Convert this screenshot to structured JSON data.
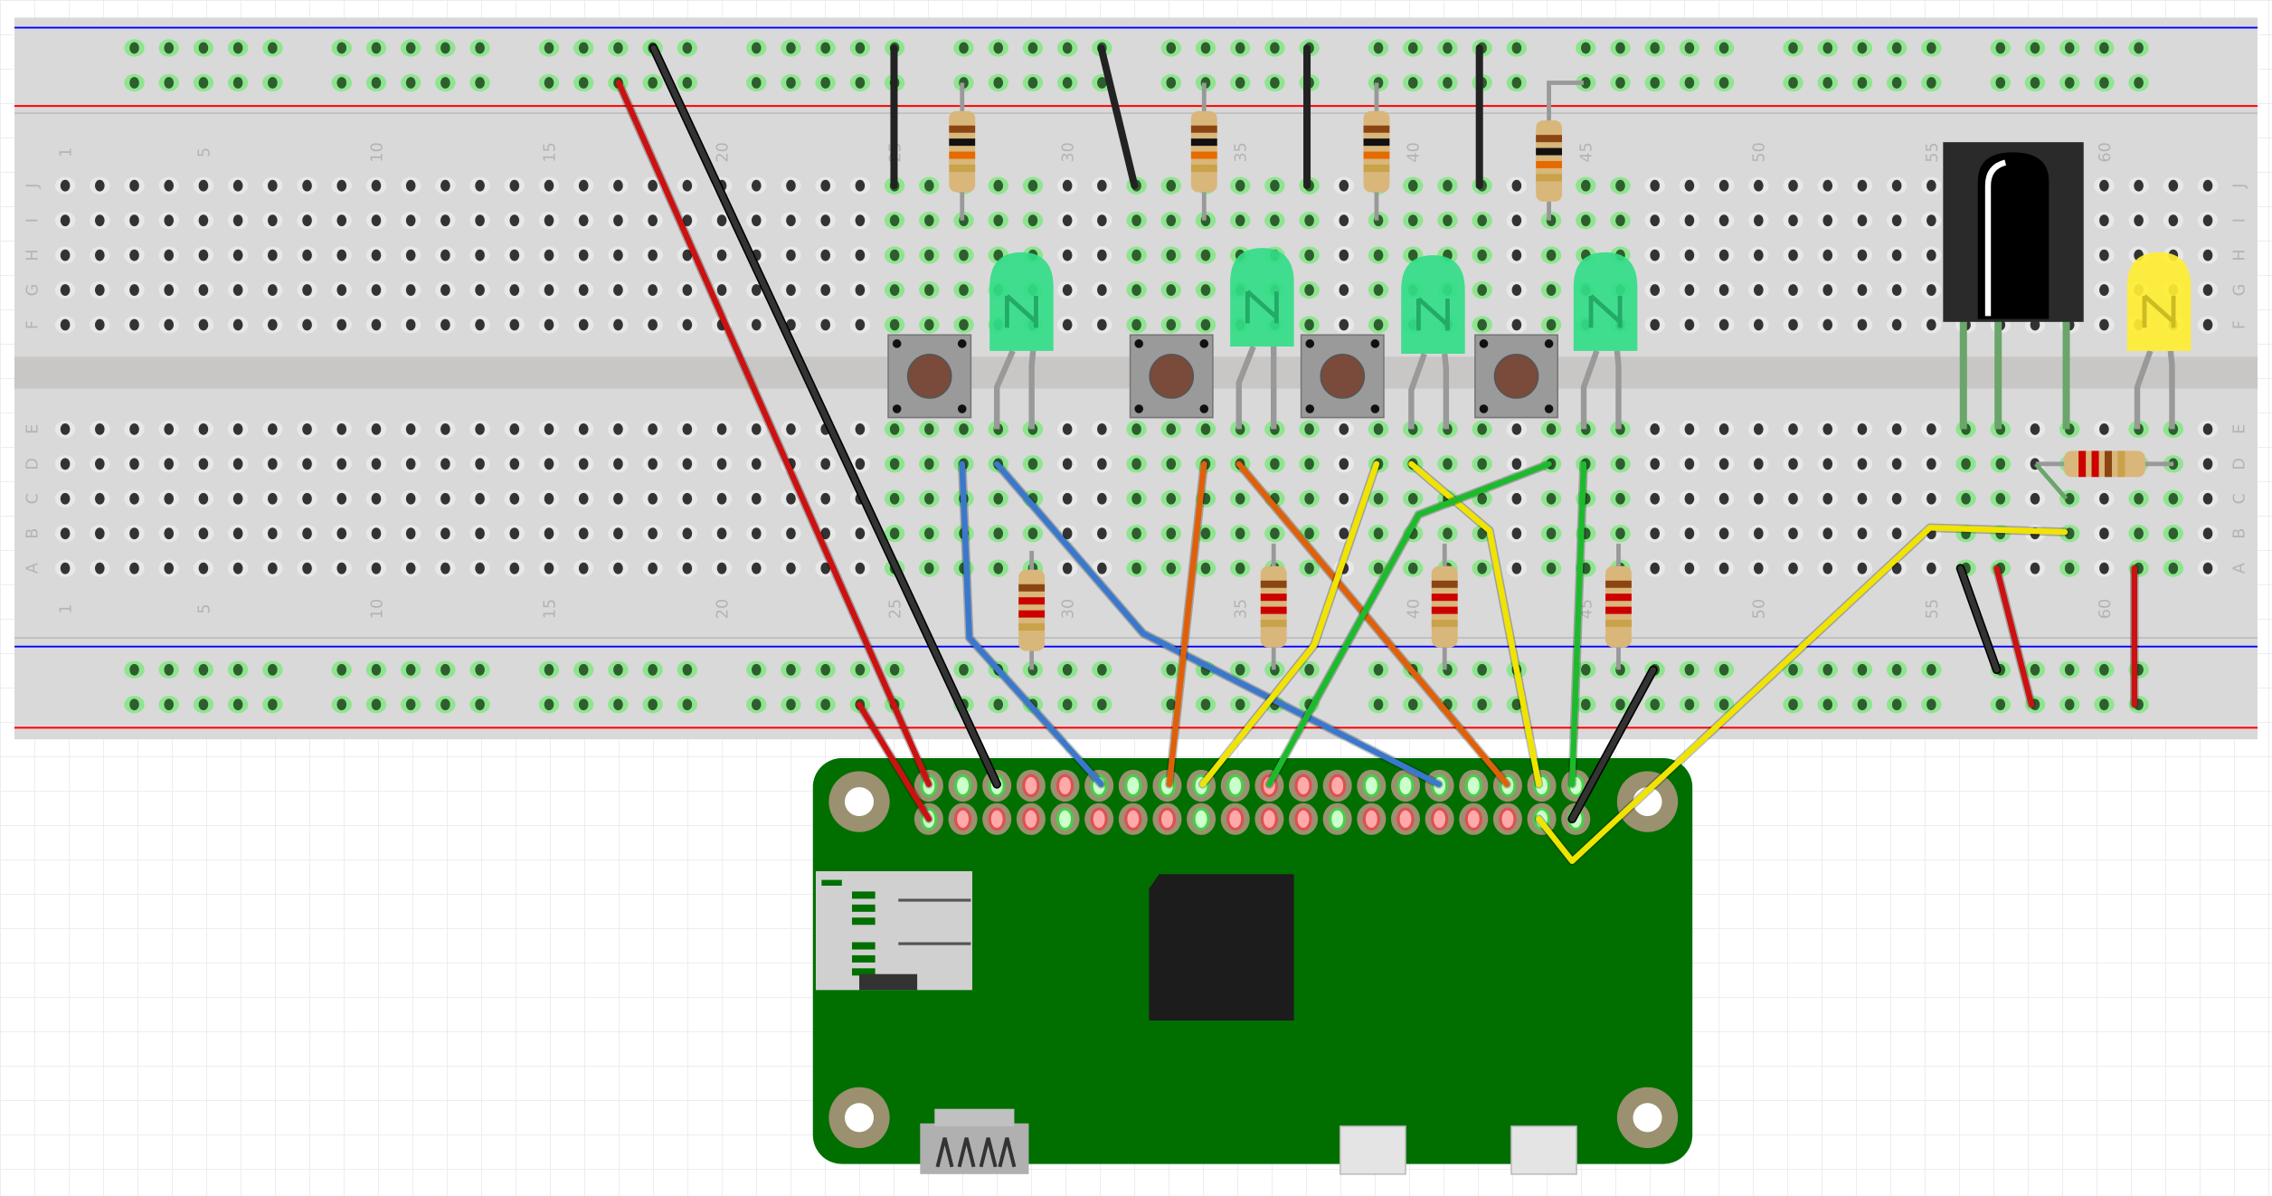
{
  "breadboard": {
    "column_labels": [
      "1",
      "5",
      "10",
      "15",
      "20",
      "25",
      "30",
      "35",
      "40",
      "45",
      "50",
      "55",
      "60"
    ],
    "row_labels_top": [
      "J",
      "I",
      "H",
      "G",
      "F"
    ],
    "row_labels_bottom": [
      "E",
      "D",
      "C",
      "B",
      "A"
    ],
    "colors": {
      "board": "#d9d9d9",
      "gap": "#c9c7c5",
      "rail_blue": "#0000ff",
      "rail_red": "#ff0000",
      "hole": "#333333",
      "hole_connected": "#2e5e2e",
      "hole_glow": "#8fe58f"
    }
  },
  "board": {
    "name": "Raspberry Pi Zero",
    "colors": {
      "pcb": "#006f00",
      "mount": "#9b9070",
      "pin_unused": "#ffaaaa",
      "pin_used": "#ccffcc",
      "chip": "#1c1c1c"
    }
  },
  "components": {
    "buttons": 4,
    "green_leds": 4,
    "yellow_leds": 1,
    "resistors": 9,
    "ir_receiver": 1
  },
  "wire_colors": {
    "red": "#cc1111",
    "black": "#333333",
    "blue": "#3a78cc",
    "orange": "#e0600a",
    "yellow": "#f0e400",
    "green": "#1cbb2c"
  }
}
